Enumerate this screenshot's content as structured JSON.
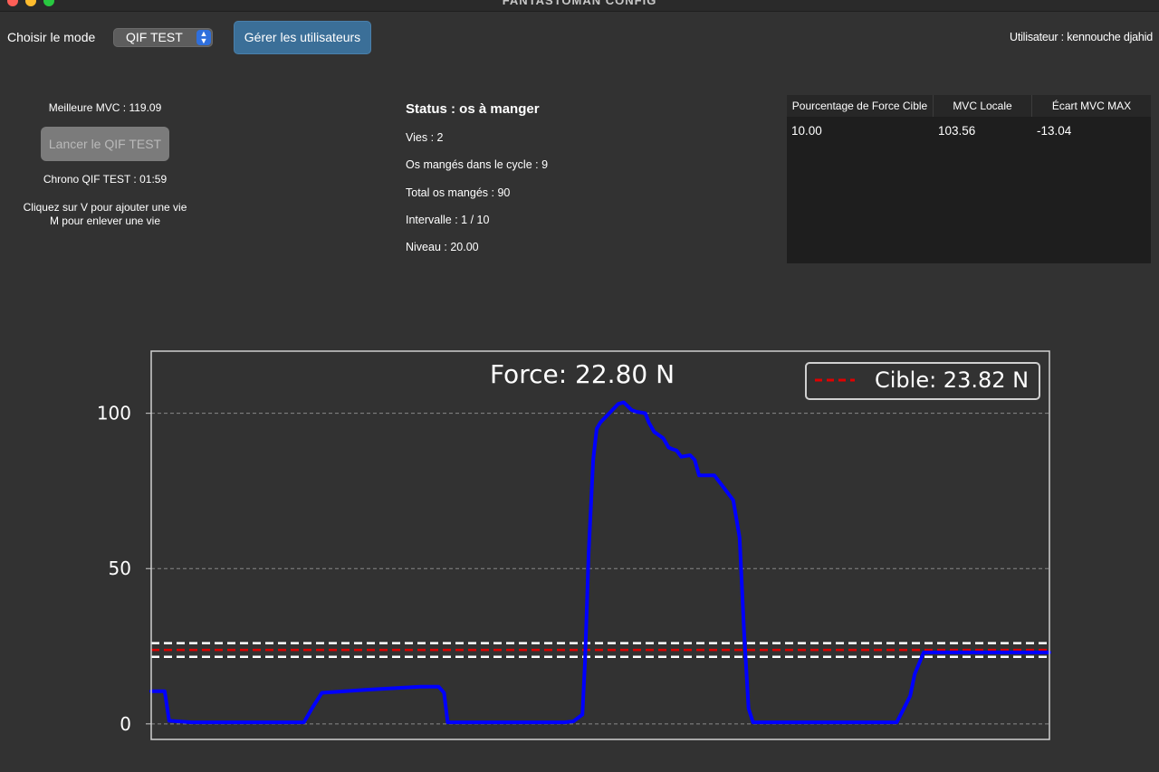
{
  "window": {
    "title": "FANTASTOMAN CONFIG"
  },
  "toolbar": {
    "mode_label": "Choisir le mode",
    "mode_selected": "QIF TEST",
    "manage_users_label": "Gérer les utilisateurs",
    "user_label": "Utilisateur : kennouche djahid"
  },
  "left_panel": {
    "best_mvc": "Meilleure MVC : 119.09",
    "launch_button": "Lancer le QIF TEST",
    "chrono": "Chrono QIF TEST : 01:59",
    "hint_line1": "Cliquez sur V pour ajouter une vie",
    "hint_line2": "M pour enlever une vie"
  },
  "status": {
    "title": "Status : os à manger",
    "lines": [
      "Vies : 2",
      "Os mangés dans le cycle : 9",
      "Total os mangés : 90",
      "Intervalle : 1 / 10",
      "Niveau : 20.00"
    ]
  },
  "table": {
    "headers": [
      "Pourcentage de Force Cible",
      "MVC Locale",
      "Écart MVC MAX"
    ],
    "rows": [
      [
        "10.00",
        "103.56",
        "-13.04"
      ]
    ]
  },
  "colors": {
    "line": "#0000ff",
    "target": "#e00000",
    "band": "#ffffff",
    "grid": "#888888",
    "background": "#323232",
    "button_primary": "#3b6f98"
  },
  "chart_data": {
    "type": "line",
    "title": "Force: 22.80 N",
    "legend": {
      "label": "Cible: 23.82 N",
      "placement": "top-right"
    },
    "y_ticks": [
      "0",
      "50",
      "100"
    ],
    "ylim": [
      -5,
      120
    ],
    "xlim": [
      0,
      100
    ],
    "target": 23.82,
    "band": [
      21.6,
      26.0
    ],
    "grid": "y-dashed",
    "series": [
      {
        "x": [
          0,
          1.5,
          2.0,
          4.5,
          17.0,
          18.0,
          19.0,
          24,
          30,
          32.0,
          32.6,
          33.0,
          46,
          47.0,
          48.0,
          48.3,
          48.7,
          49.2,
          49.6,
          50.0,
          51.0,
          52.0,
          52.6,
          53.5,
          54.0,
          55.0,
          55.4,
          56.0,
          57.0,
          57.6,
          58.0,
          58.5,
          59.0,
          60.0,
          60.5,
          61.0,
          61.8,
          62.7,
          63.5,
          64.8,
          65.5,
          66.0,
          66.5,
          67.0,
          83.0,
          83.8,
          84.5,
          85.0,
          86.0,
          100
        ],
        "y": [
          10.5,
          10.5,
          1.0,
          0.5,
          0.5,
          5.5,
          10.0,
          11.0,
          12.0,
          12.0,
          10.0,
          0.5,
          0.5,
          0.8,
          3.0,
          20.0,
          55.0,
          85.0,
          95.0,
          97.0,
          100.0,
          103.0,
          103.5,
          101.0,
          100.5,
          100.0,
          97.0,
          94.0,
          92.0,
          89.0,
          88.5,
          88.0,
          86.0,
          86.5,
          85.0,
          80.0,
          80.0,
          80.0,
          77.0,
          72.0,
          60.0,
          30.0,
          5.0,
          0.5,
          0.5,
          5.0,
          9.0,
          16.0,
          23.0,
          23.0
        ]
      }
    ]
  }
}
